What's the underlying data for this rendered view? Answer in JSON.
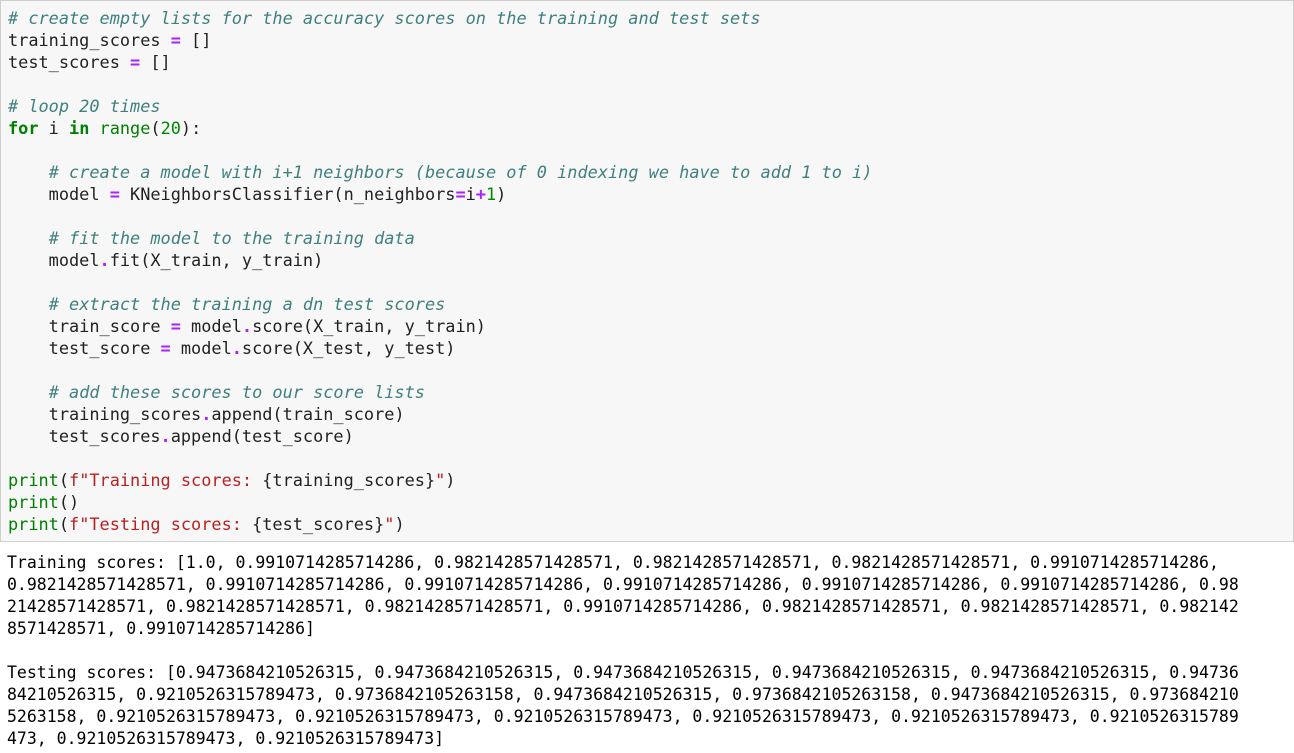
{
  "code_lines": [
    [
      {
        "t": "# create empty lists for the accuracy scores on the training and test sets",
        "c": "cm"
      }
    ],
    [
      {
        "t": "training_scores ",
        "c": "plain"
      },
      {
        "t": "=",
        "c": "op"
      },
      {
        "t": " []",
        "c": "plain"
      }
    ],
    [
      {
        "t": "test_scores ",
        "c": "plain"
      },
      {
        "t": "=",
        "c": "op"
      },
      {
        "t": " []",
        "c": "plain"
      }
    ],
    [],
    [
      {
        "t": "# loop 20 times",
        "c": "cm"
      }
    ],
    [
      {
        "t": "for",
        "c": "kw"
      },
      {
        "t": " i ",
        "c": "plain"
      },
      {
        "t": "in",
        "c": "kw"
      },
      {
        "t": " ",
        "c": "plain"
      },
      {
        "t": "range",
        "c": "nb"
      },
      {
        "t": "(",
        "c": "plain"
      },
      {
        "t": "20",
        "c": "num"
      },
      {
        "t": "):",
        "c": "plain"
      }
    ],
    [],
    [
      {
        "t": "    ",
        "c": "plain"
      },
      {
        "t": "# create a model with i+1 neighbors (because of 0 indexing we have to add 1 to i)",
        "c": "cm"
      }
    ],
    [
      {
        "t": "    model ",
        "c": "plain"
      },
      {
        "t": "=",
        "c": "op"
      },
      {
        "t": " KNeighborsClassifier(n_neighbors",
        "c": "plain"
      },
      {
        "t": "=",
        "c": "op"
      },
      {
        "t": "i",
        "c": "plain"
      },
      {
        "t": "+",
        "c": "op"
      },
      {
        "t": "1",
        "c": "num"
      },
      {
        "t": ")",
        "c": "plain"
      }
    ],
    [],
    [
      {
        "t": "    ",
        "c": "plain"
      },
      {
        "t": "# fit the model to the training data",
        "c": "cm"
      }
    ],
    [
      {
        "t": "    model",
        "c": "plain"
      },
      {
        "t": ".",
        "c": "op"
      },
      {
        "t": "fit(X_train, y_train)",
        "c": "plain"
      }
    ],
    [],
    [
      {
        "t": "    ",
        "c": "plain"
      },
      {
        "t": "# extract the training a dn test scores",
        "c": "cm"
      }
    ],
    [
      {
        "t": "    train_score ",
        "c": "plain"
      },
      {
        "t": "=",
        "c": "op"
      },
      {
        "t": " model",
        "c": "plain"
      },
      {
        "t": ".",
        "c": "op"
      },
      {
        "t": "score(X_train, y_train)",
        "c": "plain"
      }
    ],
    [
      {
        "t": "    test_score ",
        "c": "plain"
      },
      {
        "t": "=",
        "c": "op"
      },
      {
        "t": " model",
        "c": "plain"
      },
      {
        "t": ".",
        "c": "op"
      },
      {
        "t": "score(X_test, y_test)",
        "c": "plain"
      }
    ],
    [],
    [
      {
        "t": "    ",
        "c": "plain"
      },
      {
        "t": "# add these scores to our score lists",
        "c": "cm"
      }
    ],
    [
      {
        "t": "    training_scores",
        "c": "plain"
      },
      {
        "t": ".",
        "c": "op"
      },
      {
        "t": "append(train_score)",
        "c": "plain"
      }
    ],
    [
      {
        "t": "    test_scores",
        "c": "plain"
      },
      {
        "t": ".",
        "c": "op"
      },
      {
        "t": "append(test_score)",
        "c": "plain"
      }
    ],
    [],
    [
      {
        "t": "print",
        "c": "nb"
      },
      {
        "t": "(",
        "c": "plain"
      },
      {
        "t": "f\"Training scores: ",
        "c": "str"
      },
      {
        "t": "{training_scores}",
        "c": "plain"
      },
      {
        "t": "\"",
        "c": "str"
      },
      {
        "t": ")",
        "c": "plain"
      }
    ],
    [
      {
        "t": "print",
        "c": "nb"
      },
      {
        "t": "()",
        "c": "plain"
      }
    ],
    [
      {
        "t": "print",
        "c": "nb"
      },
      {
        "t": "(",
        "c": "plain"
      },
      {
        "t": "f\"Testing scores: ",
        "c": "str"
      },
      {
        "t": "{test_scores}",
        "c": "plain"
      },
      {
        "t": "\"",
        "c": "str"
      },
      {
        "t": ")",
        "c": "plain"
      }
    ]
  ],
  "output_lines": [
    "Training scores: [1.0, 0.9910714285714286, 0.9821428571428571, 0.9821428571428571, 0.9821428571428571, 0.9910714285714286,",
    "0.9821428571428571, 0.9910714285714286, 0.9910714285714286, 0.9910714285714286, 0.9910714285714286, 0.9910714285714286, 0.98",
    "21428571428571, 0.9821428571428571, 0.9821428571428571, 0.9910714285714286, 0.9821428571428571, 0.9821428571428571, 0.982142",
    "8571428571, 0.9910714285714286]",
    "",
    "Testing scores: [0.9473684210526315, 0.9473684210526315, 0.9473684210526315, 0.9473684210526315, 0.9473684210526315, 0.94736",
    "84210526315, 0.9210526315789473, 0.9736842105263158, 0.9473684210526315, 0.9736842105263158, 0.9473684210526315, 0.973684210",
    "5263158, 0.9210526315789473, 0.9210526315789473, 0.9210526315789473, 0.9210526315789473, 0.9210526315789473, 0.9210526315789",
    "473, 0.9210526315789473, 0.9210526315789473]"
  ]
}
